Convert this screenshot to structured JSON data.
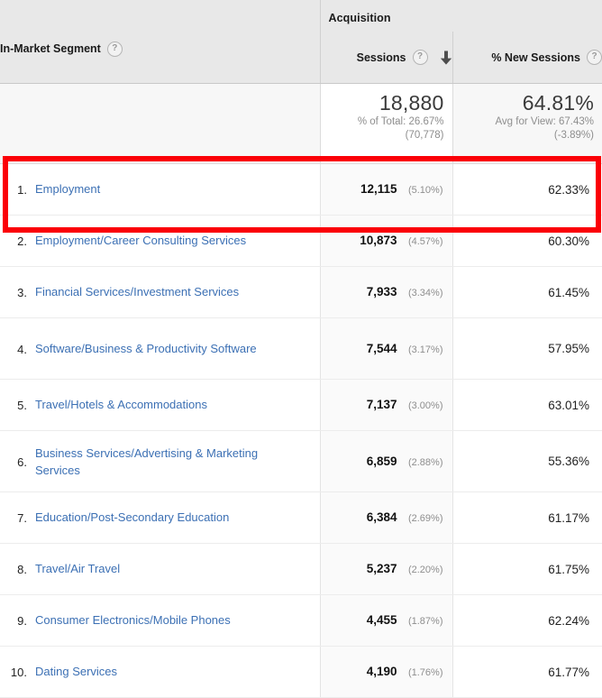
{
  "table": {
    "dimension_header": {
      "label": "In-Market Segment",
      "help_icon": "help-circle-icon"
    },
    "group_header": {
      "label": "Acquisition"
    },
    "metrics": [
      {
        "label": "Sessions",
        "help_icon": "help-circle-icon",
        "sorted": true,
        "sort_icon": "sort-descending-arrow-icon"
      },
      {
        "label": "% New Sessions",
        "help_icon": "help-circle-icon",
        "sorted": false
      }
    ],
    "summary": {
      "sessions": {
        "value": "18,880",
        "line1": "% of Total: 26.67%",
        "line2": "(70,778)"
      },
      "new_sessions": {
        "value": "64.81%",
        "line1": "Avg for View: 67.43%",
        "line2": "(-3.89%)"
      }
    },
    "rows": [
      {
        "rank": "1.",
        "name": "Employment",
        "sessions": "12,115",
        "sessions_pct": "(5.10%)",
        "new_sessions": "62.33%",
        "multiline": false
      },
      {
        "rank": "2.",
        "name": "Employment/Career Consulting Services",
        "sessions": "10,873",
        "sessions_pct": "(4.57%)",
        "new_sessions": "60.30%",
        "multiline": false
      },
      {
        "rank": "3.",
        "name": "Financial Services/Investment Services",
        "sessions": "7,933",
        "sessions_pct": "(3.34%)",
        "new_sessions": "61.45%",
        "multiline": false
      },
      {
        "rank": "4.",
        "name": "Software/Business & Productivity Software",
        "sessions": "7,544",
        "sessions_pct": "(3.17%)",
        "new_sessions": "57.95%",
        "multiline": true
      },
      {
        "rank": "5.",
        "name": "Travel/Hotels & Accommodations",
        "sessions": "7,137",
        "sessions_pct": "(3.00%)",
        "new_sessions": "63.01%",
        "multiline": false
      },
      {
        "rank": "6.",
        "name": "Business Services/Advertising & Marketing Services",
        "sessions": "6,859",
        "sessions_pct": "(2.88%)",
        "new_sessions": "55.36%",
        "multiline": true
      },
      {
        "rank": "7.",
        "name": "Education/Post-Secondary Education",
        "sessions": "6,384",
        "sessions_pct": "(2.69%)",
        "new_sessions": "61.17%",
        "multiline": false
      },
      {
        "rank": "8.",
        "name": "Travel/Air Travel",
        "sessions": "5,237",
        "sessions_pct": "(2.20%)",
        "new_sessions": "61.75%",
        "multiline": false
      },
      {
        "rank": "9.",
        "name": "Consumer Electronics/Mobile Phones",
        "sessions": "4,455",
        "sessions_pct": "(1.87%)",
        "new_sessions": "62.24%",
        "multiline": false
      },
      {
        "rank": "10.",
        "name": "Dating Services",
        "sessions": "4,190",
        "sessions_pct": "(1.76%)",
        "new_sessions": "61.77%",
        "multiline": false
      }
    ],
    "annotation": {
      "type": "rectangle-highlight",
      "color": "#fb0007",
      "covers_rows": [
        "1.",
        "2."
      ]
    }
  }
}
